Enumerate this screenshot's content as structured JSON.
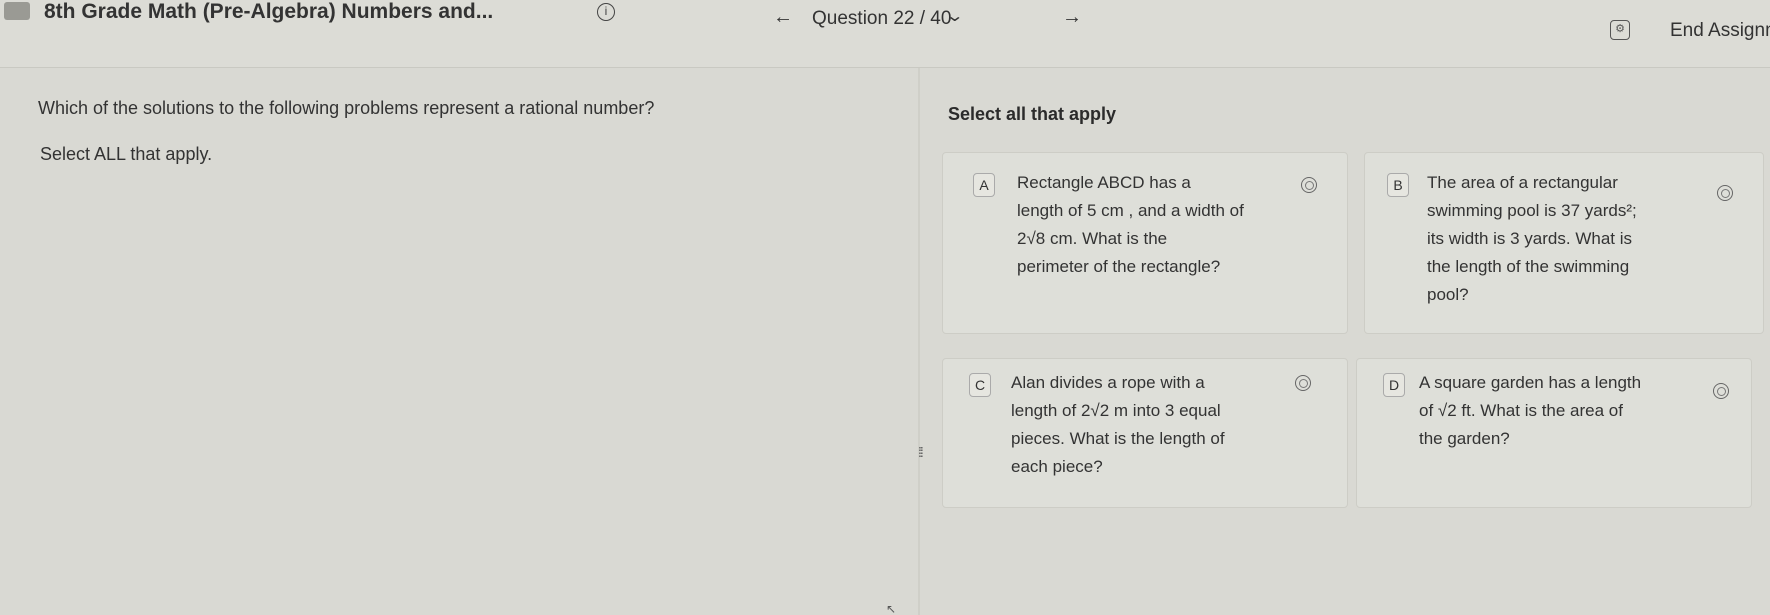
{
  "header": {
    "assignment_title": "8th Grade Math (Pre-Algebra) Numbers and...",
    "info_symbol": "i",
    "prev_arrow": "←",
    "question_counter": "Question 22 / 40",
    "chevron": "⌄",
    "next_arrow": "→",
    "settings_symbol": "⚙",
    "end_assignment_label": "End Assignm"
  },
  "left_panel": {
    "question_prompt": "Which of the solutions to the following problems represent a rational number?",
    "instruction": "Select ALL that apply."
  },
  "right_panel": {
    "header": "Select all that apply",
    "choices": [
      {
        "letter": "A",
        "line1": "Rectangle ABCD has a",
        "line2": "length of 5 cm , and a width of",
        "line3": "2√8 cm. What is the",
        "line4": "perimeter of the rectangle?"
      },
      {
        "letter": "B",
        "line1": "The area of a rectangular",
        "line2": "swimming pool is 37 yards²;",
        "line3": "its width is 3 yards. What is",
        "line4": "the length of the swimming",
        "line5": "pool?"
      },
      {
        "letter": "C",
        "line1": "Alan divides a rope with a",
        "line2": "length of 2√2 m into 3 equal",
        "line3": "pieces. What is the length of",
        "line4": "each piece?"
      },
      {
        "letter": "D",
        "line1": "A square garden has a length",
        "line2": "of √2 ft. What is the area of",
        "line3": "the garden?"
      }
    ]
  },
  "icons": {
    "drag_handle": "⁞⁞",
    "cursor": "↖"
  }
}
